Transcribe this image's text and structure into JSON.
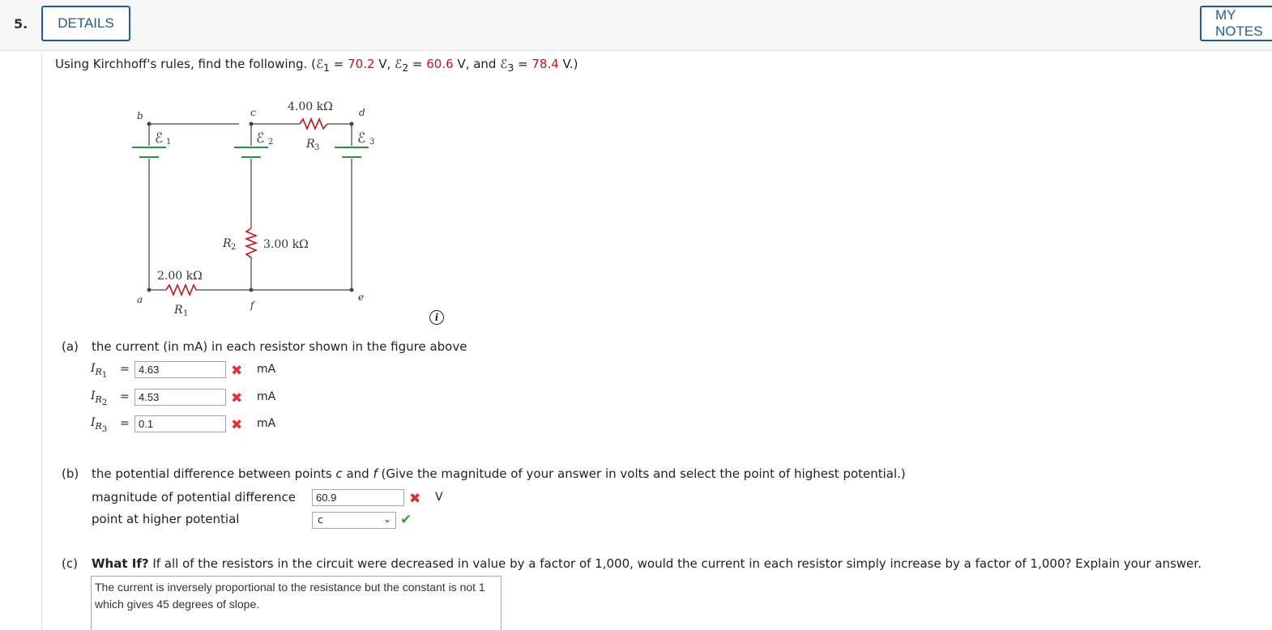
{
  "header": {
    "question_number": "5.",
    "details_label": "DETAILS",
    "my_notes_label": "MY NOTES"
  },
  "prompt": {
    "lead": "Using Kirchhoff's rules, find the following. (",
    "emf1_symbol": "ℰ",
    "emf1_sub": "1",
    "eq1": " = ",
    "emf1_value": "70.2",
    "sep1": " V, ",
    "emf2_symbol": "ℰ",
    "emf2_sub": "2",
    "eq2": " = ",
    "emf2_value": "60.6",
    "sep2": " V, and ",
    "emf3_symbol": "ℰ",
    "emf3_sub": "3",
    "eq3": " = ",
    "emf3_value": "78.4",
    "tail": " V.)"
  },
  "circuit": {
    "node_b": "b",
    "node_c": "c",
    "node_d": "d",
    "node_a": "a",
    "node_f": "f",
    "node_e": "e",
    "emf1_label": "ℰ",
    "emf1_sub": "1",
    "emf2_label": "ℰ",
    "emf2_sub": "2",
    "emf3_label": "ℰ",
    "emf3_sub": "3",
    "r3_value": "4.00 kΩ",
    "r3_name": "R",
    "r3_sub": "3",
    "r2_name": "R",
    "r2_sub": "2",
    "r2_value": "3.00 kΩ",
    "r1_value": "2.00 kΩ",
    "r1_name": "R",
    "r1_sub": "1"
  },
  "info_icon": "i",
  "part_a": {
    "label": "(a)",
    "text": "the current (in mA) in each resistor shown in the figure above",
    "rows": [
      {
        "var": "I",
        "sub": "R",
        "subsub": "1",
        "eq": "=",
        "value": "4.63",
        "unit": "mA",
        "status": "incorrect"
      },
      {
        "var": "I",
        "sub": "R",
        "subsub": "2",
        "eq": "=",
        "value": "4.53",
        "unit": "mA",
        "status": "incorrect"
      },
      {
        "var": "I",
        "sub": "R",
        "subsub": "3",
        "eq": "=",
        "value": "0.1",
        "unit": "mA",
        "status": "incorrect"
      }
    ]
  },
  "part_b": {
    "label": "(b)",
    "text_pre": "the potential difference between points ",
    "point1": "c",
    "text_and": " and ",
    "point2": "f",
    "text_post": " (Give the magnitude of your answer in volts and select the point of highest potential.)",
    "magnitude_label": "magnitude of potential difference",
    "magnitude_value": "60.9",
    "magnitude_unit": "V",
    "magnitude_status": "incorrect",
    "higher_label": "point at higher potential",
    "higher_selected": "c",
    "higher_status": "correct"
  },
  "part_c": {
    "label": "(c)",
    "what_if": "What If?",
    "text": " If all of the resistors in the circuit were decreased in value by a factor of 1,000, would the current in each resistor simply increase by a factor of 1,000? Explain your answer.",
    "answer": "The current is inversely proportional to the resistance but the constant is not 1 which gives 45 degrees of slope."
  },
  "colors": {
    "accent": "#1f5d96",
    "given_value": "#c0141c",
    "incorrect": "#e03232",
    "correct": "#3a9a3a",
    "battery": "#2f8f3f"
  }
}
